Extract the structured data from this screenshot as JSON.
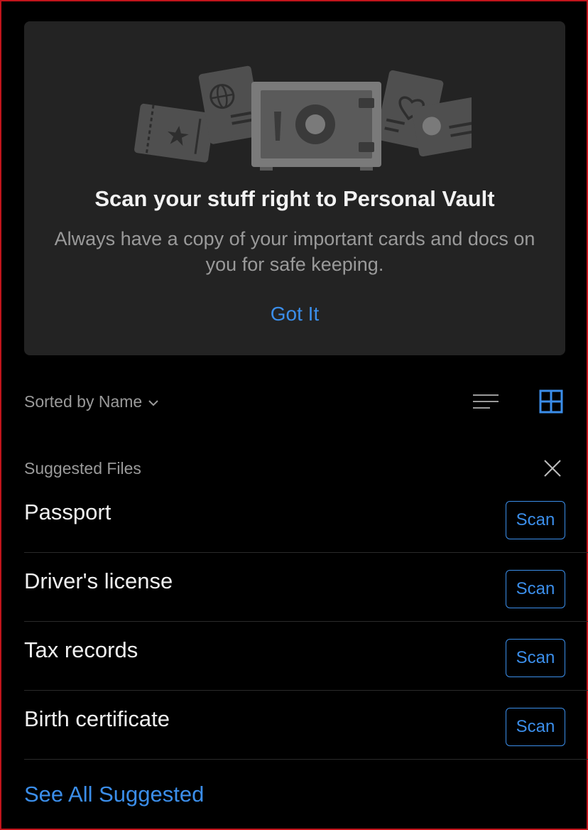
{
  "promo": {
    "title": "Scan your stuff right to Personal Vault",
    "body": "Always have a copy of your important cards and docs on you for safe keeping.",
    "action": "Got It",
    "illustration_icons": [
      "ticket-icon",
      "passport-icon",
      "vault-safe-icon",
      "health-card-icon",
      "id-card-icon"
    ]
  },
  "sort": {
    "label": "Sorted by Name",
    "view_modes": [
      "list-view-icon",
      "grid-view-icon"
    ],
    "active_view": "grid"
  },
  "suggested": {
    "title": "Suggested Files",
    "items": [
      {
        "label": "Passport",
        "action": "Scan"
      },
      {
        "label": "Driver's license",
        "action": "Scan"
      },
      {
        "label": "Tax records",
        "action": "Scan"
      },
      {
        "label": "Birth certificate",
        "action": "Scan"
      }
    ],
    "see_all": "See All Suggested"
  },
  "colors": {
    "background": "#000000",
    "card": "#232323",
    "accent": "#3b8eea",
    "muted_text": "#9a9a9a",
    "illustration": "#555555"
  }
}
